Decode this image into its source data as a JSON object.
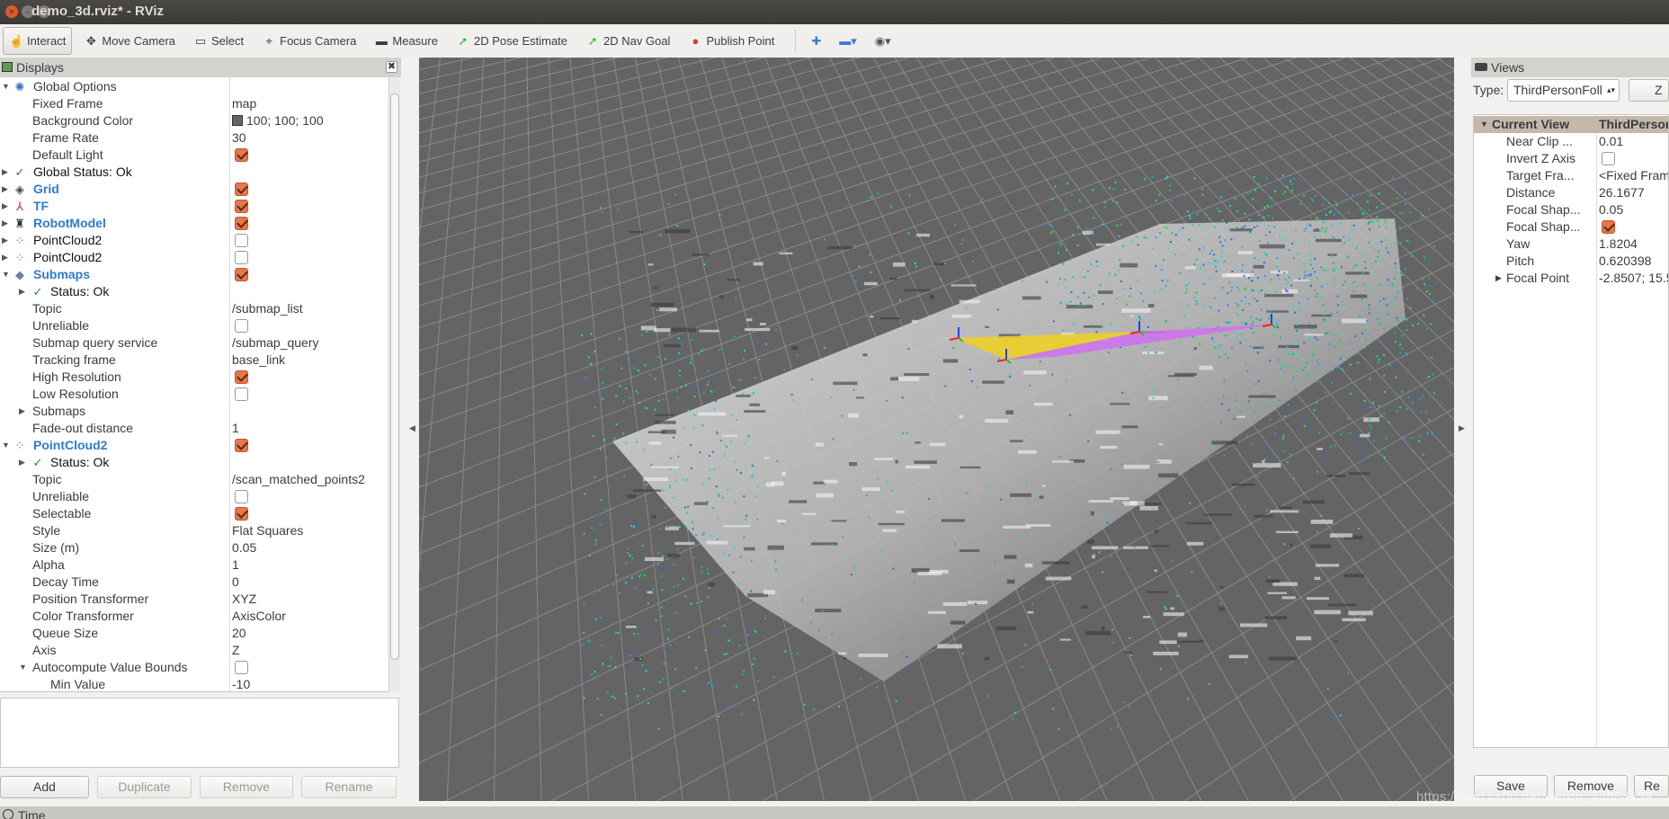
{
  "window": {
    "title": "demo_3d.rviz* - RViz"
  },
  "toolbar": {
    "tools": [
      {
        "label": "Interact",
        "icon": "hand-pointer-icon",
        "glyph": "☝",
        "active": true
      },
      {
        "label": "Move Camera",
        "icon": "move-camera-icon",
        "glyph": "✥"
      },
      {
        "label": "Select",
        "icon": "select-box-icon",
        "glyph": "▭"
      },
      {
        "label": "Focus Camera",
        "icon": "focus-camera-icon",
        "glyph": "⌖"
      },
      {
        "label": "Measure",
        "icon": "ruler-icon",
        "glyph": "▬"
      },
      {
        "label": "2D Pose Estimate",
        "icon": "pose-arrow-icon",
        "glyph": "➚",
        "color": "#1dbf2a"
      },
      {
        "label": "2D Nav Goal",
        "icon": "nav-goal-arrow-icon",
        "glyph": "➚",
        "color": "#1dbf2a"
      },
      {
        "label": "Publish Point",
        "icon": "map-pin-icon",
        "glyph": "●",
        "color": "#c8452c"
      }
    ],
    "extra_icons": [
      {
        "icon": "plus-icon",
        "glyph": "✚",
        "color": "#3a7fd0"
      },
      {
        "icon": "minus-dropdown-icon",
        "glyph": "▬▾",
        "color": "#3a7fd0"
      },
      {
        "icon": "eye-dropdown-icon",
        "glyph": "◉▾",
        "color": "#555"
      }
    ]
  },
  "displays": {
    "title": "Displays",
    "rows": [
      {
        "label": "Global Options",
        "level": 0,
        "exp": "down",
        "icon": "gear-icon",
        "glyph": "✺",
        "iconColor": "#3a6fc4"
      },
      {
        "label": "Fixed Frame",
        "level": 1,
        "value": "map"
      },
      {
        "label": "Background Color",
        "level": 1,
        "value": "100; 100; 100",
        "swatch": "#646464"
      },
      {
        "label": "Frame Rate",
        "level": 1,
        "value": "30"
      },
      {
        "label": "Default Light",
        "level": 1,
        "check": true
      },
      {
        "label": "Global Status: Ok",
        "level": 0,
        "exp": "right",
        "icon": "checkmark-icon",
        "glyph": "✓",
        "iconColor": "#2a8a2a",
        "dark": true
      },
      {
        "label": "Grid",
        "level": 0,
        "exp": "right",
        "icon": "grid-icon",
        "glyph": "◈",
        "iconColor": "#444",
        "bold": true,
        "check": true
      },
      {
        "label": "TF",
        "level": 0,
        "exp": "right",
        "icon": "tf-axes-icon",
        "glyph": "⅄",
        "iconColor": "#c03030",
        "bold": true,
        "check": true
      },
      {
        "label": "RobotModel",
        "level": 0,
        "exp": "right",
        "icon": "robot-icon",
        "glyph": "♜",
        "iconColor": "#333",
        "bold": true,
        "check": true
      },
      {
        "label": "PointCloud2",
        "level": 0,
        "exp": "right",
        "icon": "point-cloud-icon",
        "glyph": "⁘",
        "iconColor": "#2a8fd8",
        "dark": true,
        "check": false
      },
      {
        "label": "PointCloud2",
        "level": 0,
        "exp": "right",
        "icon": "point-cloud-icon",
        "glyph": "⁘",
        "iconColor": "#2a8fd8",
        "dark": true,
        "check": false
      },
      {
        "label": "Submaps",
        "level": 0,
        "exp": "down",
        "icon": "submaps-icon",
        "glyph": "◆",
        "iconColor": "#6a7fb0",
        "bold": true,
        "check": true
      },
      {
        "label": "Status: Ok",
        "level": 1,
        "exp": "right",
        "icon": "checkmark-icon",
        "glyph": "✓",
        "iconColor": "#2a8a2a",
        "dark": true
      },
      {
        "label": "Topic",
        "level": 1,
        "value": "/submap_list"
      },
      {
        "label": "Unreliable",
        "level": 1,
        "check": false
      },
      {
        "label": "Submap query service",
        "level": 1,
        "value": "/submap_query"
      },
      {
        "label": "Tracking frame",
        "level": 1,
        "value": "base_link"
      },
      {
        "label": "High Resolution",
        "level": 1,
        "check": true
      },
      {
        "label": "Low Resolution",
        "level": 1,
        "check": false
      },
      {
        "label": "Submaps",
        "level": 1,
        "exp": "right"
      },
      {
        "label": "Fade-out distance",
        "level": 1,
        "value": "1"
      },
      {
        "label": "PointCloud2",
        "level": 0,
        "exp": "down",
        "icon": "point-cloud-icon",
        "glyph": "⁘",
        "iconColor": "#2a8fd8",
        "bold": true,
        "check": true
      },
      {
        "label": "Status: Ok",
        "level": 1,
        "exp": "right",
        "icon": "checkmark-icon",
        "glyph": "✓",
        "iconColor": "#2a8a2a",
        "dark": true
      },
      {
        "label": "Topic",
        "level": 1,
        "value": "/scan_matched_points2"
      },
      {
        "label": "Unreliable",
        "level": 1,
        "check": false
      },
      {
        "label": "Selectable",
        "level": 1,
        "check": true
      },
      {
        "label": "Style",
        "level": 1,
        "value": "Flat Squares"
      },
      {
        "label": "Size (m)",
        "level": 1,
        "value": "0.05"
      },
      {
        "label": "Alpha",
        "level": 1,
        "value": "1"
      },
      {
        "label": "Decay Time",
        "level": 1,
        "value": "0"
      },
      {
        "label": "Position Transformer",
        "level": 1,
        "value": "XYZ"
      },
      {
        "label": "Color Transformer",
        "level": 1,
        "value": "AxisColor"
      },
      {
        "label": "Queue Size",
        "level": 1,
        "value": "20"
      },
      {
        "label": "Axis",
        "level": 1,
        "value": "Z"
      },
      {
        "label": "Autocompute Value Bounds",
        "level": 1,
        "exp": "down",
        "check": false
      },
      {
        "label": "Min Value",
        "level": 2,
        "value": "-10"
      }
    ],
    "buttons": {
      "add": "Add",
      "duplicate": "Duplicate",
      "remove": "Remove",
      "rename": "Rename"
    }
  },
  "views": {
    "title": "Views",
    "type_label": "Type:",
    "type_value": "ThirdPersonFoll",
    "zero_label": "Z",
    "header": {
      "label": "Current View",
      "value": "ThirdPerson"
    },
    "rows": [
      {
        "label": "Near Clip ...",
        "value": "0.01"
      },
      {
        "label": "Invert Z Axis",
        "check": false
      },
      {
        "label": "Target Fra...",
        "value": "<Fixed Fram"
      },
      {
        "label": "Distance",
        "value": "26.1677"
      },
      {
        "label": "Focal Shap...",
        "value": "0.05"
      },
      {
        "label": "Focal Shap...",
        "check": true
      },
      {
        "label": "Yaw",
        "value": "1.8204"
      },
      {
        "label": "Pitch",
        "value": "0.620398"
      },
      {
        "label": "Focal Point",
        "value": "-2.8507; 15.5",
        "exp": "right"
      }
    ],
    "buttons": {
      "save": "Save",
      "remove": "Remove",
      "rename": "Re"
    }
  },
  "time_panel": {
    "title": "Time"
  },
  "watermark": "https://blog.csdn.net/weixin_44684139",
  "colors": {
    "background": "#646464",
    "checkbox": "#e6774a",
    "accent_blue": "#2f7bcf",
    "cloud_green": "#1ee06a",
    "cloud_cyan": "#20d8d0",
    "cloud_blue": "#2a6fe0",
    "trajectory_yellow": "#f0d020",
    "trajectory_magenta": "#d070f0"
  }
}
